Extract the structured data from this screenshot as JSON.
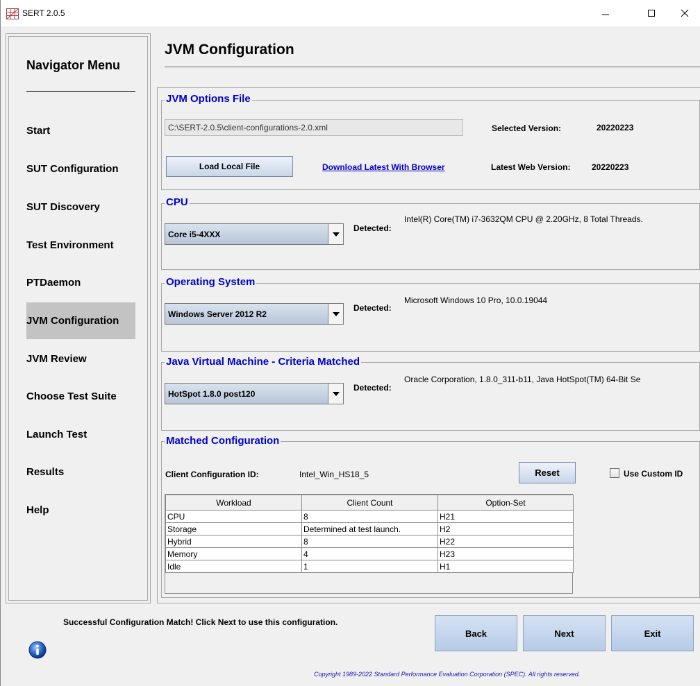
{
  "window": {
    "title": "SERT 2.0.5"
  },
  "nav": {
    "title": "Navigator Menu",
    "items": [
      {
        "label": "Start"
      },
      {
        "label": "SUT Configuration"
      },
      {
        "label": "SUT Discovery"
      },
      {
        "label": "Test Environment"
      },
      {
        "label": "PTDaemon"
      },
      {
        "label": "JVM Configuration",
        "selected": true
      },
      {
        "label": "JVM Review"
      },
      {
        "label": "Choose Test Suite"
      },
      {
        "label": "Launch Test"
      },
      {
        "label": "Results"
      },
      {
        "label": "Help"
      }
    ]
  },
  "page": {
    "title": "JVM Configuration"
  },
  "options_file": {
    "group_title": "JVM Options File",
    "path": "C:\\SERT-2.0.5\\client-configurations-2.0.xml",
    "selected_version_label": "Selected Version:",
    "selected_version": "20220223",
    "load_button": "Load Local File",
    "download_link": "Download Latest With Browser",
    "latest_web_version_label": "Latest Web Version:",
    "latest_web_version": "20220223"
  },
  "cpu": {
    "group_title": "CPU",
    "selected": "Core i5-4XXX",
    "detected_label": "Detected:",
    "detected": "Intel(R) Core(TM) i7-3632QM CPU @ 2.20GHz, 8 Total Threads."
  },
  "os": {
    "group_title": "Operating System",
    "selected": "Windows Server 2012 R2",
    "detected_label": "Detected:",
    "detected": "Microsoft Windows 10 Pro, 10.0.19044"
  },
  "jvm": {
    "group_title": "Java Virtual Machine - Criteria Matched",
    "selected": "HotSpot 1.8.0 post120",
    "detected_label": "Detected:",
    "detected": "Oracle Corporation, 1.8.0_311-b11, Java HotSpot(TM) 64-Bit Se"
  },
  "matched": {
    "group_title": "Matched Configuration",
    "client_id_label": "Client Configuration ID:",
    "client_id": "Intel_Win_HS18_5",
    "reset_button": "Reset",
    "custom_id_label": "Use Custom ID",
    "custom_id_checked": false,
    "columns": [
      "Workload",
      "Client Count",
      "Option-Set"
    ],
    "rows": [
      [
        "CPU",
        "8",
        "H21"
      ],
      [
        "Storage",
        "Determined at test launch.",
        "H2"
      ],
      [
        "Hybrid",
        "8",
        "H22"
      ],
      [
        "Memory",
        "4",
        "H23"
      ],
      [
        "Idle",
        "1",
        "H1"
      ]
    ]
  },
  "footer": {
    "status": "Successful Configuration Match! Click Next to use this configuration.",
    "back_button": "Back",
    "next_button": "Next",
    "exit_button": "Exit",
    "copyright": "Copyright 1989-2022 Standard Performance Evaluation Corporation (SPEC). All rights reserved."
  }
}
